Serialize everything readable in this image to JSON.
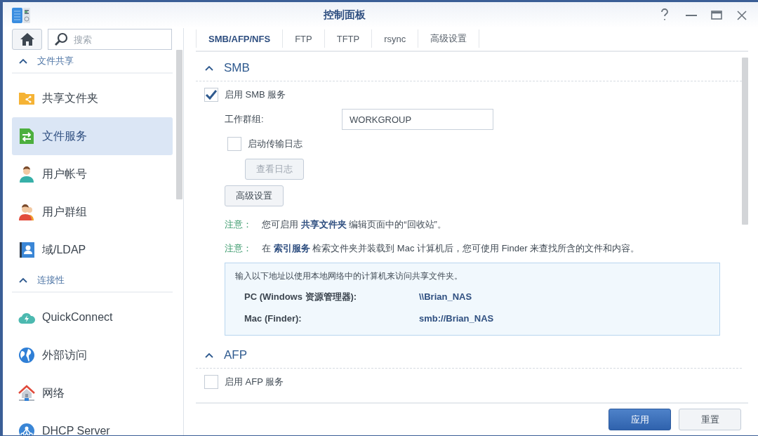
{
  "window": {
    "title": "控制面板"
  },
  "search": {
    "placeholder": "搜索"
  },
  "sidebar": {
    "groups": [
      {
        "title": "文件共享",
        "expanded": true,
        "items": [
          {
            "label": "共享文件夹",
            "selected": false
          },
          {
            "label": "文件服务",
            "selected": true
          },
          {
            "label": "用户帐号",
            "selected": false
          },
          {
            "label": "用户群组",
            "selected": false
          },
          {
            "label": "域/LDAP",
            "selected": false
          }
        ]
      },
      {
        "title": "连接性",
        "expanded": true,
        "items": [
          {
            "label": "QuickConnect",
            "selected": false
          },
          {
            "label": "外部访问",
            "selected": false
          },
          {
            "label": "网络",
            "selected": false
          },
          {
            "label": "DHCP Server",
            "selected": false
          }
        ]
      }
    ]
  },
  "tabs": [
    {
      "label": "SMB/AFP/NFS",
      "selected": true
    },
    {
      "label": "FTP",
      "selected": false
    },
    {
      "label": "TFTP",
      "selected": false
    },
    {
      "label": "rsync",
      "selected": false
    },
    {
      "label": "高级设置",
      "selected": false
    }
  ],
  "sections": [
    {
      "title": "SMB",
      "expanded": true,
      "rows": [
        {
          "kind": "checkbox",
          "label": "启用 SMB 服务",
          "checked": true,
          "children": [
            {
              "kind": "field",
              "label": "工作群组:",
              "value": "WORKGROUP"
            },
            {
              "kind": "checkbox",
              "label": "启动传输日志",
              "checked": false,
              "children": [
                {
                  "kind": "button",
                  "label": "查看日志",
                  "disabled": true
                }
              ]
            },
            {
              "kind": "button",
              "label": "高级设置",
              "disabled": false
            },
            {
              "kind": "note",
              "label": "注意：",
              "text": "您可启用 **共享文件夹** 编辑页面中的“回收站”。"
            },
            {
              "kind": "note",
              "label": "注意：",
              "text": "在 **索引服务** 检索文件夹并装载到 Mac 计算机后，您可使用 Finder 来查找所含的文件和内容。"
            },
            {
              "kind": "info",
              "text": "输入以下地址以使用本地网络中的计算机来访问共享文件夹。",
              "entries": [
                {
                  "label": "PC (Windows 资源管理器):",
                  "value": "\\\\Brian_NAS"
                },
                {
                  "label": "Mac (Finder):",
                  "value": "smb://Brian_NAS"
                }
              ]
            }
          ]
        }
      ]
    },
    {
      "title": "AFP",
      "expanded": true,
      "rows": [
        {
          "kind": "checkbox",
          "label": "启用 AFP 服务",
          "checked": false
        }
      ]
    }
  ],
  "footer": {
    "buttons": [
      {
        "label": "应用",
        "kind": "primary"
      },
      {
        "label": "重置",
        "kind": "default"
      }
    ]
  }
}
